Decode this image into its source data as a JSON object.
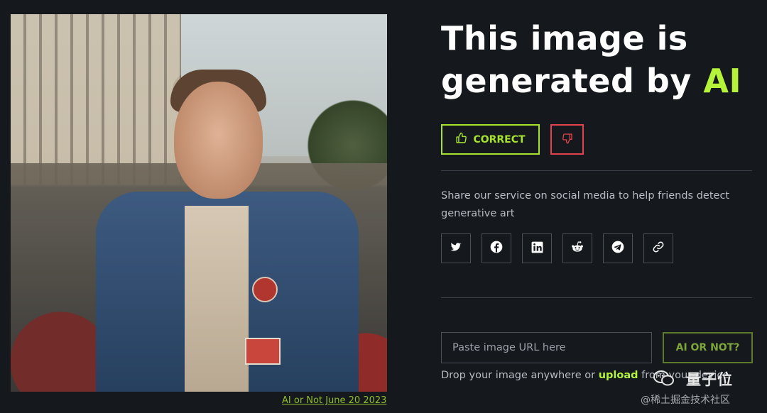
{
  "photo": {
    "caption": "AI or Not June 20 2023"
  },
  "result": {
    "headline_prefix": "This image is generated by ",
    "headline_accent": "AI",
    "correct_label": "CORRECT"
  },
  "share": {
    "text": "Share our service on social media to help friends detect generative art",
    "buttons": [
      "twitter-icon",
      "facebook-icon",
      "linkedin-icon",
      "reddit-icon",
      "telegram-icon",
      "link-icon"
    ]
  },
  "check": {
    "url_placeholder": "Paste image URL here",
    "url_value": "",
    "submit_label": "AI OR NOT?",
    "drop_prefix": "Drop your image anywhere or ",
    "drop_link": "upload",
    "drop_suffix": " from your device"
  },
  "watermark": {
    "name": "量子位",
    "sub": "@稀土掘金技术社区"
  },
  "colors": {
    "background": "#15181d",
    "accent": "#b4f33a",
    "danger": "#e0434b"
  }
}
